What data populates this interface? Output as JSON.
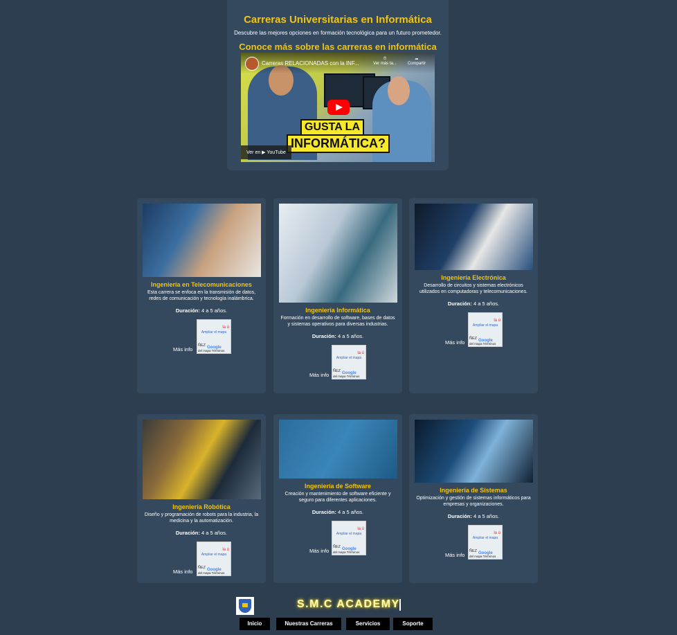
{
  "hero": {
    "title": "Carreras Universitarias en Informática",
    "subtitle": "Descubre las mejores opciones en formación tecnológica para un futuro prometedor.",
    "video_heading": "Conoce más sobre las carreras en informática",
    "video": {
      "title": "Carreras RELACIONADAS con la INF...",
      "watch_later": "Ver más ta...",
      "share": "Compartir",
      "banner_line1": "GUSTA LA",
      "banner_line2": "INFORMÁTICA?",
      "watch_on": "Ver en  ▶ YouTube"
    }
  },
  "map": {
    "enlarge": "Ampliar el mapa",
    "nez": "ÑEZ",
    "google": "Google",
    "terms": "del mapa  Términos",
    "pin": "la ú"
  },
  "duration_label": "Duración:",
  "cards": [
    {
      "title": "Ingeniería en Telecomunicaciones",
      "description": "Esta carrera se enfoca en la transmisión de datos, redes de comunicación y tecnología inalámbrica.",
      "duration": "4 a 5 años.",
      "more": "Más info"
    },
    {
      "title": "Ingeniería Informática",
      "description": "Formación en desarrollo de software, bases de datos y sistemas operativos para diversas industrias.",
      "duration": "4 a 5 años.",
      "more": "Más info"
    },
    {
      "title": "Ingeniería Electrónica",
      "description": "Desarrollo de circuitos y sistemas electrónicos utilizados en computadoras y telecomunicaciones.",
      "duration": "4 a 5 años.",
      "more": "Más info"
    },
    {
      "title": "Ingeniería Robótica",
      "description": "Diseño y programación de robots para la industria, la medicina y la automatización.",
      "duration": "4 a 5 años.",
      "more": "Más info"
    },
    {
      "title": "Ingeniería de Software",
      "description": "Creación y mantenimiento de software eficiente y seguro para diferentes aplicaciones.",
      "duration": "4 a 5 años.",
      "more": "Más info"
    },
    {
      "title": "Ingeniería de Sistemas",
      "description": "Optimización y gestión de sistemas informáticos para empresas y organizaciones.",
      "duration": "4 a 5 años.",
      "more": "Más info"
    }
  ],
  "footer": {
    "brand": "S.M.C ACADEMY",
    "nav": [
      "Inicio",
      "Nuestras Carreras",
      "Servicios",
      "Soporte"
    ]
  },
  "colors": {
    "background": "#2c3e50",
    "card": "#34495e",
    "accent": "#f1c40f"
  }
}
